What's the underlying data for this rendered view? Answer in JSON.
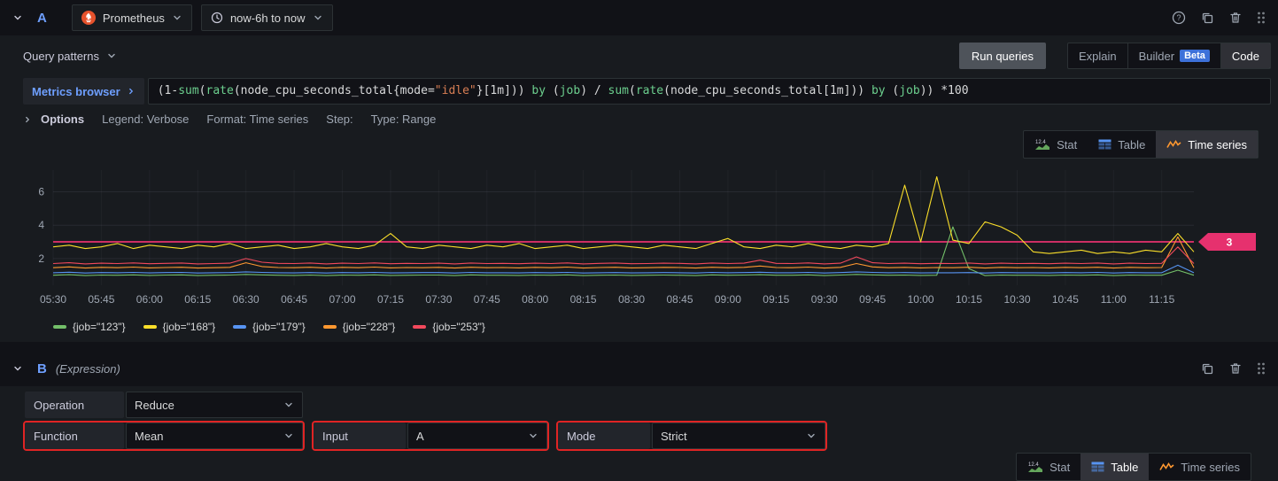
{
  "colors": {
    "highlight_red": "#e02424",
    "accent_blue": "#3d71d9",
    "link_blue": "#6e9fff",
    "threshold_pink": "#e6316e",
    "prometheus_orange": "#e6522c"
  },
  "query_a": {
    "ref": "A",
    "datasource": "Prometheus",
    "time_range": "now-6h to now",
    "query_patterns_label": "Query patterns",
    "run_queries_label": "Run queries",
    "mode_explain": "Explain",
    "mode_builder": "Builder",
    "mode_builder_badge": "Beta",
    "mode_code": "Code",
    "metrics_browser_label": "Metrics browser",
    "options_label": "Options",
    "options_legend": "Legend: Verbose",
    "options_format": "Format: Time series",
    "options_step": "Step:",
    "options_type": "Type: Range",
    "viz": {
      "stat": "Stat",
      "stat_icon_value": "12.4",
      "table": "Table",
      "timeseries": "Time series",
      "active": "Time series"
    }
  },
  "expression_tokens": [
    {
      "text": "(1-",
      "type": "plain"
    },
    {
      "text": "sum",
      "type": "func"
    },
    {
      "text": "(",
      "type": "plain"
    },
    {
      "text": "rate",
      "type": "func"
    },
    {
      "text": "(node_cpu_seconds_total{mode=",
      "type": "plain"
    },
    {
      "text": "\"idle\"",
      "type": "string"
    },
    {
      "text": "}[1m])) ",
      "type": "plain"
    },
    {
      "text": "by",
      "type": "func"
    },
    {
      "text": " (",
      "type": "plain"
    },
    {
      "text": "job",
      "type": "func"
    },
    {
      "text": ") / ",
      "type": "plain"
    },
    {
      "text": "sum",
      "type": "func"
    },
    {
      "text": "(",
      "type": "plain"
    },
    {
      "text": "rate",
      "type": "func"
    },
    {
      "text": "(node_cpu_seconds_total[1m])) ",
      "type": "plain"
    },
    {
      "text": "by",
      "type": "func"
    },
    {
      "text": " (",
      "type": "plain"
    },
    {
      "text": "job",
      "type": "func"
    },
    {
      "text": ")) *100",
      "type": "plain"
    }
  ],
  "chart_data": {
    "type": "line",
    "points": 72,
    "x_tick_labels": [
      "05:30",
      "05:45",
      "06:00",
      "06:15",
      "06:30",
      "06:45",
      "07:00",
      "07:15",
      "07:30",
      "07:45",
      "08:00",
      "08:15",
      "08:30",
      "08:45",
      "09:00",
      "09:15",
      "09:30",
      "09:45",
      "10:00",
      "10:15",
      "10:30",
      "10:45",
      "11:00",
      "11:15"
    ],
    "ylim": [
      0.4,
      7.3
    ],
    "yticks": [
      2,
      4,
      6
    ],
    "grid": true,
    "legend_position": "bottom",
    "threshold": {
      "value": 3,
      "label": "3",
      "color": "#e6316e"
    },
    "series": [
      {
        "name": "{job=\"123\"}",
        "color": "#73bf69",
        "values": [
          1.0,
          1.03,
          0.98,
          1.01,
          1.0,
          1.02,
          0.99,
          1.01,
          1.02,
          0.98,
          1.0,
          1.01,
          1.05,
          1.02,
          1.0,
          0.99,
          1.01,
          0.98,
          1.01,
          1.0,
          1.02,
          0.99,
          1.0,
          1.01,
          1.01,
          0.98,
          1.02,
          1.0,
          1.0,
          0.99,
          1.01,
          1.0,
          1.02,
          0.98,
          1.0,
          1.01,
          0.99,
          1.0,
          1.01,
          1.0,
          0.98,
          1.02,
          1.0,
          1.01,
          1.03,
          1.0,
          1.0,
          1.02,
          0.98,
          1.01,
          1.05,
          1.02,
          1.0,
          1.01,
          0.99,
          1.0,
          3.9,
          1.4,
          0.98,
          1.01,
          1.0,
          1.0,
          0.99,
          1.01,
          1.0,
          1.02,
          0.98,
          1.01,
          1.0,
          1.0,
          1.3,
          1.0
        ]
      },
      {
        "name": "{job=\"168\"}",
        "color": "#fade2a",
        "values": [
          2.7,
          2.8,
          2.6,
          2.7,
          2.9,
          2.6,
          2.8,
          2.7,
          2.6,
          2.8,
          2.7,
          2.9,
          2.6,
          2.7,
          2.8,
          2.6,
          2.7,
          2.9,
          2.7,
          2.6,
          2.8,
          3.5,
          2.7,
          2.6,
          2.8,
          2.7,
          2.6,
          2.8,
          2.7,
          2.9,
          2.6,
          2.7,
          2.8,
          2.6,
          2.7,
          2.8,
          2.7,
          2.6,
          2.8,
          2.7,
          2.6,
          2.9,
          3.2,
          2.7,
          2.6,
          2.8,
          2.7,
          2.9,
          2.7,
          2.6,
          2.8,
          2.7,
          2.9,
          6.4,
          3.0,
          6.9,
          3.1,
          2.9,
          4.2,
          3.9,
          3.4,
          2.4,
          2.3,
          2.4,
          2.5,
          2.3,
          2.4,
          2.3,
          2.5,
          2.4,
          3.5,
          2.4
        ]
      },
      {
        "name": "{job=\"179\"}",
        "color": "#5794f2",
        "values": [
          1.15,
          1.18,
          1.13,
          1.16,
          1.15,
          1.17,
          1.14,
          1.16,
          1.17,
          1.13,
          1.15,
          1.16,
          1.2,
          1.17,
          1.15,
          1.14,
          1.16,
          1.13,
          1.16,
          1.15,
          1.17,
          1.14,
          1.15,
          1.16,
          1.16,
          1.13,
          1.17,
          1.15,
          1.15,
          1.14,
          1.16,
          1.15,
          1.17,
          1.13,
          1.15,
          1.16,
          1.14,
          1.15,
          1.16,
          1.15,
          1.13,
          1.17,
          1.15,
          1.16,
          1.18,
          1.15,
          1.15,
          1.17,
          1.13,
          1.16,
          1.2,
          1.17,
          1.15,
          1.16,
          1.14,
          1.15,
          1.15,
          1.16,
          1.13,
          1.16,
          1.15,
          1.15,
          1.14,
          1.16,
          1.15,
          1.17,
          1.13,
          1.16,
          1.15,
          1.15,
          1.6,
          1.15
        ]
      },
      {
        "name": "{job=\"228\"}",
        "color": "#ff9830",
        "values": [
          1.45,
          1.5,
          1.43,
          1.47,
          1.45,
          1.49,
          1.44,
          1.46,
          1.48,
          1.43,
          1.45,
          1.47,
          1.75,
          1.52,
          1.46,
          1.45,
          1.48,
          1.43,
          1.47,
          1.45,
          1.49,
          1.44,
          1.46,
          1.45,
          1.47,
          1.43,
          1.48,
          1.45,
          1.46,
          1.44,
          1.47,
          1.45,
          1.49,
          1.43,
          1.46,
          1.48,
          1.44,
          1.45,
          1.47,
          1.46,
          1.43,
          1.48,
          1.45,
          1.47,
          1.55,
          1.46,
          1.45,
          1.49,
          1.43,
          1.47,
          1.7,
          1.5,
          1.45,
          1.47,
          1.44,
          1.46,
          1.45,
          1.48,
          1.43,
          1.47,
          1.45,
          1.46,
          1.44,
          1.47,
          1.45,
          1.48,
          1.43,
          1.47,
          1.45,
          1.46,
          3.3,
          1.45
        ]
      },
      {
        "name": "{job=\"253\"}",
        "color": "#f2495c",
        "values": [
          1.7,
          1.75,
          1.68,
          1.72,
          1.7,
          1.74,
          1.69,
          1.71,
          1.73,
          1.68,
          1.7,
          1.72,
          2.0,
          1.78,
          1.71,
          1.7,
          1.73,
          1.68,
          1.72,
          1.7,
          1.74,
          1.69,
          1.71,
          1.7,
          1.72,
          1.68,
          1.73,
          1.7,
          1.71,
          1.69,
          1.72,
          1.7,
          1.74,
          1.68,
          1.71,
          1.73,
          1.69,
          1.7,
          1.72,
          1.71,
          1.68,
          1.73,
          1.7,
          1.72,
          1.9,
          1.71,
          1.7,
          1.74,
          1.68,
          1.72,
          2.1,
          1.75,
          1.7,
          1.72,
          1.69,
          1.71,
          1.7,
          1.73,
          1.68,
          1.72,
          1.7,
          1.71,
          1.69,
          1.72,
          1.7,
          1.73,
          1.68,
          1.72,
          1.7,
          1.71,
          2.7,
          1.7
        ]
      }
    ]
  },
  "query_b": {
    "ref": "B",
    "kind": "(Expression)",
    "operation_label": "Operation",
    "operation_value": "Reduce",
    "function_label": "Function",
    "function_value": "Mean",
    "input_label": "Input",
    "input_value": "A",
    "mode_label": "Mode",
    "mode_value": "Strict",
    "viz": {
      "stat": "Stat",
      "stat_icon_value": "12.4",
      "table": "Table",
      "timeseries": "Time series",
      "active": "Table"
    }
  }
}
